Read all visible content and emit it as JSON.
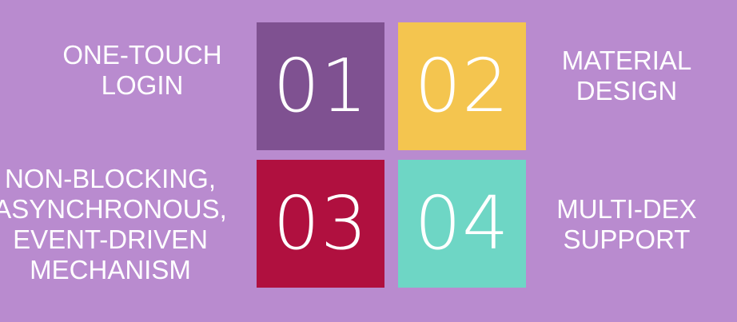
{
  "colors": {
    "background": "#b98bcf",
    "tile_01": "#7f5191",
    "tile_02": "#f4c54f",
    "tile_03": "#b0103f",
    "tile_04": "#6ed6c5",
    "text": "#ffffff"
  },
  "tiles": [
    {
      "number": "01",
      "label": "ONE-TOUCH\nLOGIN"
    },
    {
      "number": "02",
      "label": "MATERIAL\nDESIGN"
    },
    {
      "number": "03",
      "label": "NON-BLOCKING,\nASYNCHRONOUS,\nEVENT-DRIVEN\nMECHANISM"
    },
    {
      "number": "04",
      "label": "MULTI-DEX\nSUPPORT"
    }
  ]
}
